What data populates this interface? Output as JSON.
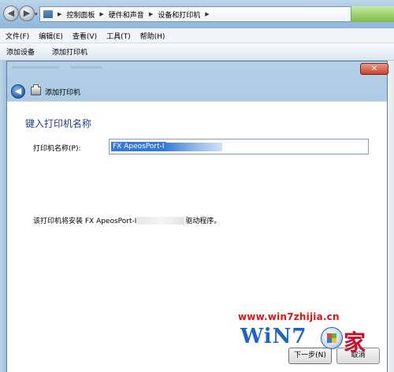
{
  "explorer": {
    "nav_back_glyph": "◀",
    "nav_forward_glyph": "▶",
    "breadcrumb": [
      "控制面板",
      "硬件和声音",
      "设备和打印机"
    ],
    "menu": [
      "文件(F)",
      "编辑(E)",
      "查看(V)",
      "工具(T)",
      "帮助(H)"
    ],
    "toolbar": [
      "添加设备",
      "添加打印机"
    ]
  },
  "dialog": {
    "title": "添加打印机",
    "close_glyph": "✕",
    "back_glyph": "◀",
    "heading": "键入打印机名称",
    "field_label": "打印机名称(P):",
    "field_value": "FX ApeosPort-I",
    "info_prefix": "该打印机将安装 FX ApeosPort-I",
    "info_suffix": "驱动程序。",
    "next_button": "下一步(N)",
    "cancel_button": "取消"
  },
  "watermark": {
    "url": "www.win7zhijia.cn",
    "logo": "WiN7",
    "home": "家"
  },
  "colors": {
    "heading": "#1e3f8a",
    "selection": "#3578d6",
    "watermark_url": "#e01414",
    "watermark_logo": "#1f63c4"
  },
  "icons": [
    "back-arrow-icon",
    "forward-arrow-icon",
    "folder-icon",
    "printer-icon",
    "close-icon",
    "windows-flag-icon"
  ]
}
